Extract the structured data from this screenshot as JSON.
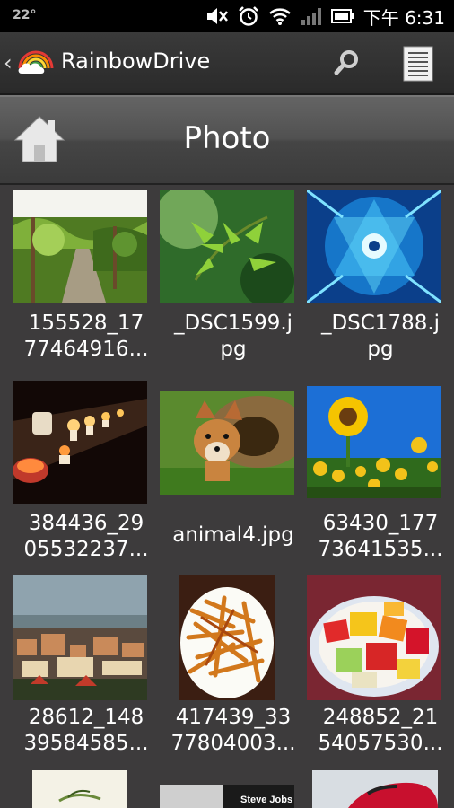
{
  "status_bar": {
    "temperature": "22°",
    "time": "下午 6:31",
    "icons": [
      "mute-icon",
      "alarm-icon",
      "wifi-icon",
      "signal-icon",
      "battery-icon"
    ]
  },
  "action_bar": {
    "title": "RainbowDrive",
    "icons": [
      "back-chevron-icon",
      "rainbow-cloud-logo",
      "search-icon",
      "list-menu-icon"
    ]
  },
  "header": {
    "title": "Photo",
    "home_icon": "home-icon"
  },
  "files": [
    {
      "line1": "155528_17",
      "line2": "77464916...",
      "thumb": "vineyard-path"
    },
    {
      "line1": "_DSC1599.j",
      "line2": "pg",
      "thumb": "green-leaves"
    },
    {
      "line1": "_DSC1788.j",
      "line2": "pg",
      "thumb": "blue-kaleidoscope"
    },
    {
      "line1": "384436_29",
      "line2": "05532237...",
      "thumb": "candles"
    },
    {
      "line1": "animal4.jpg",
      "line2": "",
      "thumb": "fox"
    },
    {
      "line1": "63430_177",
      "line2": "73641535...",
      "thumb": "sunflowers"
    },
    {
      "line1": "28612_148",
      "line2": "39584585...",
      "thumb": "city-skyline"
    },
    {
      "line1": "417439_33",
      "line2": "77804003...",
      "thumb": "french-fries"
    },
    {
      "line1": "248852_21",
      "line2": "54057530...",
      "thumb": "fruit-bowl"
    },
    {
      "line1": "",
      "line2": "",
      "thumb": "plate-dish"
    },
    {
      "line1": "",
      "line2": "",
      "thumb": "steve-jobs"
    },
    {
      "line1": "",
      "line2": "",
      "thumb": "red-car"
    }
  ],
  "colors": {
    "background": "#3d3b3c",
    "status_bar": "#000000",
    "header_band": "#515151"
  }
}
